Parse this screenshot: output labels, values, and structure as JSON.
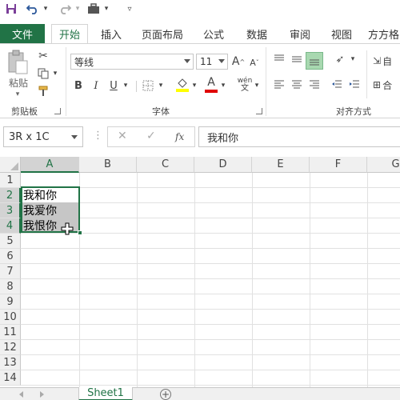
{
  "name_box": "3R x 1C",
  "formula_content": "我和你",
  "tabs": {
    "file": "文件",
    "items": [
      "开始",
      "插入",
      "页面布局",
      "公式",
      "数据",
      "审阅",
      "视图",
      "方方格"
    ]
  },
  "ribbon": {
    "paste_label": "粘贴",
    "clipboard_group": "剪贴板",
    "font_group": "字体",
    "align_group": "对齐方式",
    "font_name": "等线",
    "font_size": "11",
    "bold": "B",
    "italic": "I",
    "underline": "U",
    "grow_font": "A",
    "shrink_font": "A",
    "font_color_glyph": "A",
    "phonetic": "wén",
    "wrap_label": "自",
    "merge_label": "合"
  },
  "fx_label": "fx",
  "columns": [
    "A",
    "B",
    "C",
    "D",
    "E",
    "F",
    "G"
  ],
  "rows": [
    "1",
    "2",
    "3",
    "4",
    "5",
    "6",
    "7",
    "8",
    "9",
    "10",
    "11",
    "12",
    "13",
    "14"
  ],
  "cells": {
    "A2": "我和你",
    "A3": "我爱你",
    "A4": "我恨你"
  },
  "sheet": {
    "name": "Sheet1",
    "add_symbol": "+"
  },
  "colors": {
    "accent": "#217346",
    "selection_fill": "#c6c6c6"
  }
}
